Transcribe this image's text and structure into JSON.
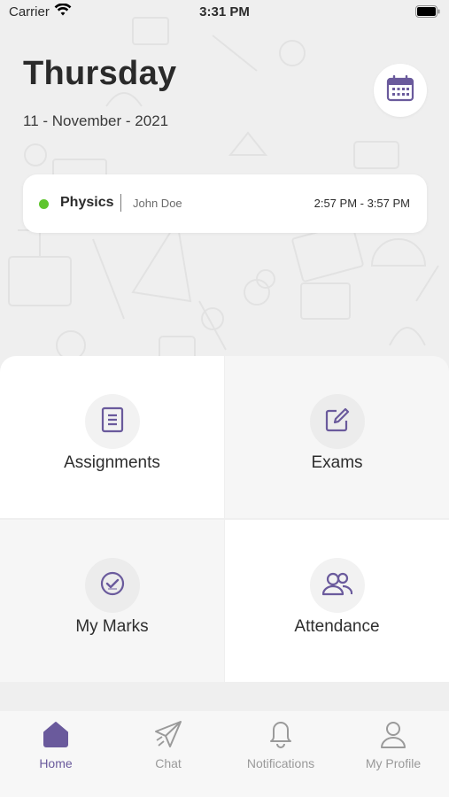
{
  "status_bar": {
    "carrier": "Carrier",
    "time": "3:31 PM"
  },
  "header": {
    "day": "Thursday",
    "date": "11 - November - 2021",
    "calendar_icon": "calendar-icon"
  },
  "current_class": {
    "subject": "Physics",
    "teacher": "John Doe",
    "time": "2:57 PM - 3:57 PM",
    "status_color": "#5fc52e"
  },
  "menu": {
    "assignments": {
      "label": "Assignments",
      "icon": "document-icon"
    },
    "exams": {
      "label": "Exams",
      "icon": "edit-icon"
    },
    "my_marks": {
      "label": "My Marks",
      "icon": "check-badge-icon"
    },
    "attendance": {
      "label": "Attendance",
      "icon": "users-icon"
    }
  },
  "tabbar": {
    "home": "Home",
    "chat": "Chat",
    "notifications": "Notifications",
    "profile": "My Profile",
    "active": "Home"
  },
  "colors": {
    "accent": "#6a5a9c",
    "inactive": "#9a9a9a",
    "background": "#efefef"
  }
}
